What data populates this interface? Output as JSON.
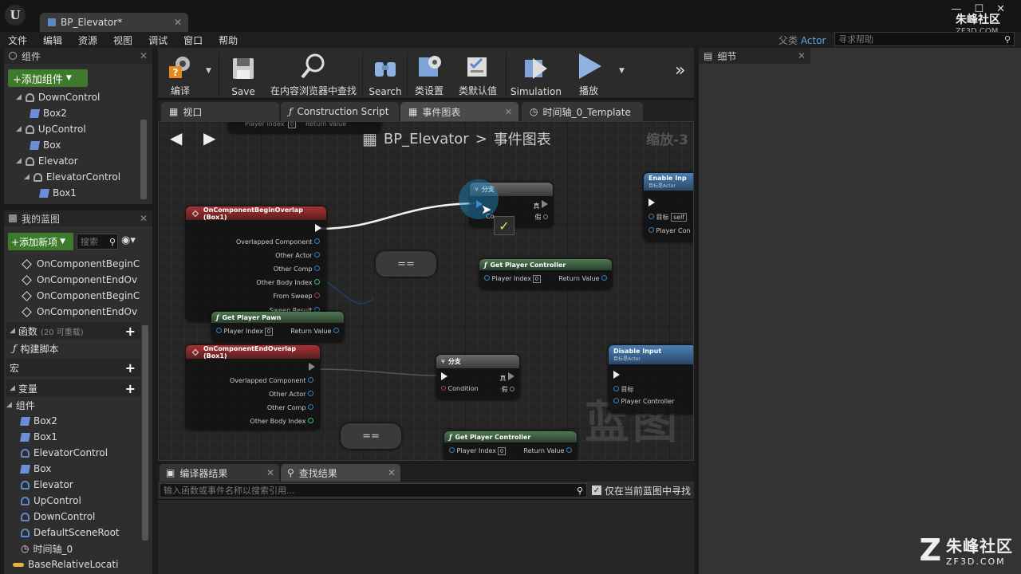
{
  "window": {
    "doc_tab": "BP_Elevator*",
    "logo_letter": "U",
    "parent_class_label": "父类",
    "parent_class_value": "Actor",
    "help_search_placeholder": "寻求帮助",
    "watermark_top_title": "朱峰社区",
    "watermark_top_sub": "ZF3D.COM"
  },
  "menu": [
    "文件",
    "编辑",
    "资源",
    "视图",
    "调试",
    "窗口",
    "帮助"
  ],
  "components_panel": {
    "title": "组件",
    "add_button": "+添加组件",
    "tree": [
      {
        "label": "DownControl",
        "level": 1,
        "icon": "scene"
      },
      {
        "label": "Box2",
        "level": 2,
        "icon": "cube"
      },
      {
        "label": "UpControl",
        "level": 1,
        "icon": "scene"
      },
      {
        "label": "Box",
        "level": 2,
        "icon": "cube"
      },
      {
        "label": "Elevator",
        "level": 1,
        "icon": "scene"
      },
      {
        "label": "ElevatorControl",
        "level": 2,
        "icon": "scene"
      },
      {
        "label": "Box1",
        "level": 3,
        "icon": "cube"
      }
    ]
  },
  "my_blueprint": {
    "title": "我的蓝图",
    "add_button": "+添加新项",
    "search_placeholder": "搜索",
    "events": [
      "OnComponentBeginC",
      "OnComponentEndOv",
      "OnComponentBeginC",
      "OnComponentEndOv"
    ],
    "functions_label": "函数",
    "functions_count": "(20 可重载)",
    "construct_script": "构建脚本",
    "macros_label": "宏",
    "variables_label": "变量",
    "components_label": "组件",
    "variables": [
      "Box2",
      "Box1",
      "ElevatorControl",
      "Box",
      "Elevator",
      "UpControl",
      "DownControl",
      "DefaultSceneRoot",
      "时间轴_0",
      "BaseRelativeLocati"
    ]
  },
  "toolbar": {
    "compile": "编译",
    "save": "Save",
    "find_in_browser": "在内容浏览器中查找",
    "search": "Search",
    "class_settings": "类设置",
    "class_defaults": "类默认值",
    "simulation": "Simulation",
    "play": "播放",
    "more": "»"
  },
  "editor_tabs": [
    "视口",
    "Construction Script",
    "事件图表",
    "时间轴_0_Template"
  ],
  "graph": {
    "breadcrumb_bp": "BP_Elevator",
    "breadcrumb_sep": ">",
    "breadcrumb_graph": "事件图表",
    "zoom": "缩放-3",
    "watermark": "蓝图",
    "nodes": {
      "begin_overlap": {
        "title": "OnComponentBeginOverlap (Box1)",
        "pins": [
          "Overlapped Component",
          "Other Actor",
          "Other Comp",
          "Other Body Index",
          "From Sweep",
          "Sweep Result"
        ]
      },
      "end_overlap": {
        "title": "OnComponentEndOverlap (Box1)",
        "pins": [
          "Overlapped Component",
          "Other Actor",
          "Other Comp",
          "Other Body Index"
        ]
      },
      "branch_top": {
        "title": "分支",
        "condition": "Co...",
        "true": "真",
        "false": "假"
      },
      "branch_bottom": {
        "title": "分支",
        "condition": "Condition",
        "true": "真",
        "false": "假"
      },
      "get_pawn": {
        "title": "Get Player Pawn",
        "player_index": "Player Index",
        "index_value": "0",
        "return": "Return Value"
      },
      "get_pc_1": {
        "title": "Get Player Controller",
        "player_index": "Player Index",
        "index_value": "0",
        "return": "Return Value"
      },
      "get_pc_2": {
        "title": "Get Player Controller",
        "player_index": "Player Index",
        "index_value": "0",
        "return": "Return Value"
      },
      "get_pc_top": {
        "player_index": "Player Index",
        "index_value": "0",
        "return": "Return Value"
      },
      "enable_input": {
        "title": "Enable Inp",
        "subtitle": "目标是Actor",
        "target": "目标",
        "target_value": "self",
        "player_controller": "Player Con"
      },
      "disable_input": {
        "title": "Disable Input",
        "subtitle": "目标是Actor",
        "target": "目标",
        "player_controller": "Player Controller"
      },
      "equal_1": "==",
      "equal_2": "=="
    }
  },
  "results": {
    "tabs": [
      "编译器结果",
      "查找结果"
    ],
    "search_placeholder": "输入函数或事件名称以搜索引用...",
    "only_current": "仅在当前蓝图中寻找"
  },
  "details_panel": {
    "title": "细节"
  },
  "corner_logo": {
    "letter": "Z",
    "title": "朱峰社区",
    "sub": "ZF3D.COM"
  },
  "colors": {
    "accent_green": "#3d7a2c",
    "event_red": "#a83232",
    "function_green": "#4e7a52",
    "input_blue": "#4a7fb5",
    "parent_link": "#5aa6e8"
  }
}
